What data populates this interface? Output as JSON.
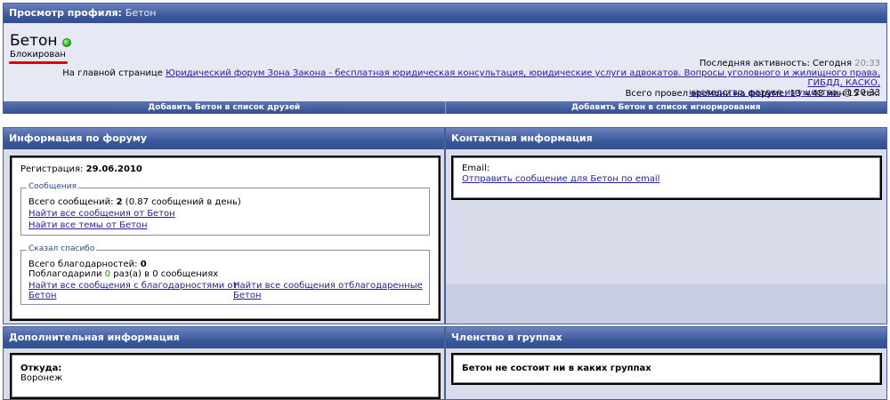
{
  "header": {
    "title": "Просмотр профиля:",
    "username": "Бетон"
  },
  "profile": {
    "username": "Бетон",
    "usertitle": "Блокирован",
    "last_activity_label": "Последняя активность: Сегодня",
    "last_activity_time": "20:33",
    "location_prefix": "На главной странице",
    "location_link_1": "Юридический форум Зона Закона - бесплатная юридическая консультация, юридические услуги адвокатов. Вопросы уголовного и жилищного права, ГИБДД, КАСКО,",
    "location_link_2": "наследство, раздел имущества.",
    "location_time": "@ 20:33",
    "total_time": "Всего провел времени на форуме: 13 ч 48 мин 15 сек.",
    "add_friend_button": "Добавить Бетон в список друзей",
    "add_ignore_button": "Добавить Бетон в список игнорирования",
    "online_color": "#34b81e",
    "highlight_color": "#e00000"
  },
  "forum_info": {
    "title": "Информация по форуму",
    "registration_label": "Регистрация:",
    "registration_date": "29.06.2010",
    "posts_legend": "Сообщения",
    "posts_label": "Всего сообщений:",
    "posts_count": "2",
    "posts_per_day": "(0.87 сообщений в день)",
    "find_posts_link": "Найти все сообщения от Бетон",
    "find_threads_link": "Найти все темы от Бетон",
    "thanks_legend": "Сказал спасибо",
    "thanks_label": "Всего благодарностей:",
    "thanks_count": "0",
    "thanked_prefix": "Поблагодарили",
    "thanked_count": "0",
    "thanked_suffix": "раз(а) в 0 сообщениях",
    "find_thanked_posts_link_1": "Найти все сообщения с благодарностями от",
    "find_thanked_posts_link_2": "Бетон",
    "find_thanked_by_link_1": "Найти все сообщения отблагодаренные",
    "find_thanked_by_link_2": "Бетон"
  },
  "contact_info": {
    "title": "Контактная информация",
    "email_label": "Email:",
    "email_link": "Отправить сообщение для Бетон по email"
  },
  "extra_info": {
    "title": "Дополнительная информация",
    "from_label": "Откуда:",
    "from_value": "Воронеж"
  },
  "groups": {
    "title": "Членство в группах",
    "none_text": "Бетон не состоит ни в каких группах"
  },
  "colors": {
    "header_blue": "#3b5a9c",
    "panel_bg": "#d9dceb",
    "link": "#22229c",
    "green_count": "#2a8a16"
  }
}
